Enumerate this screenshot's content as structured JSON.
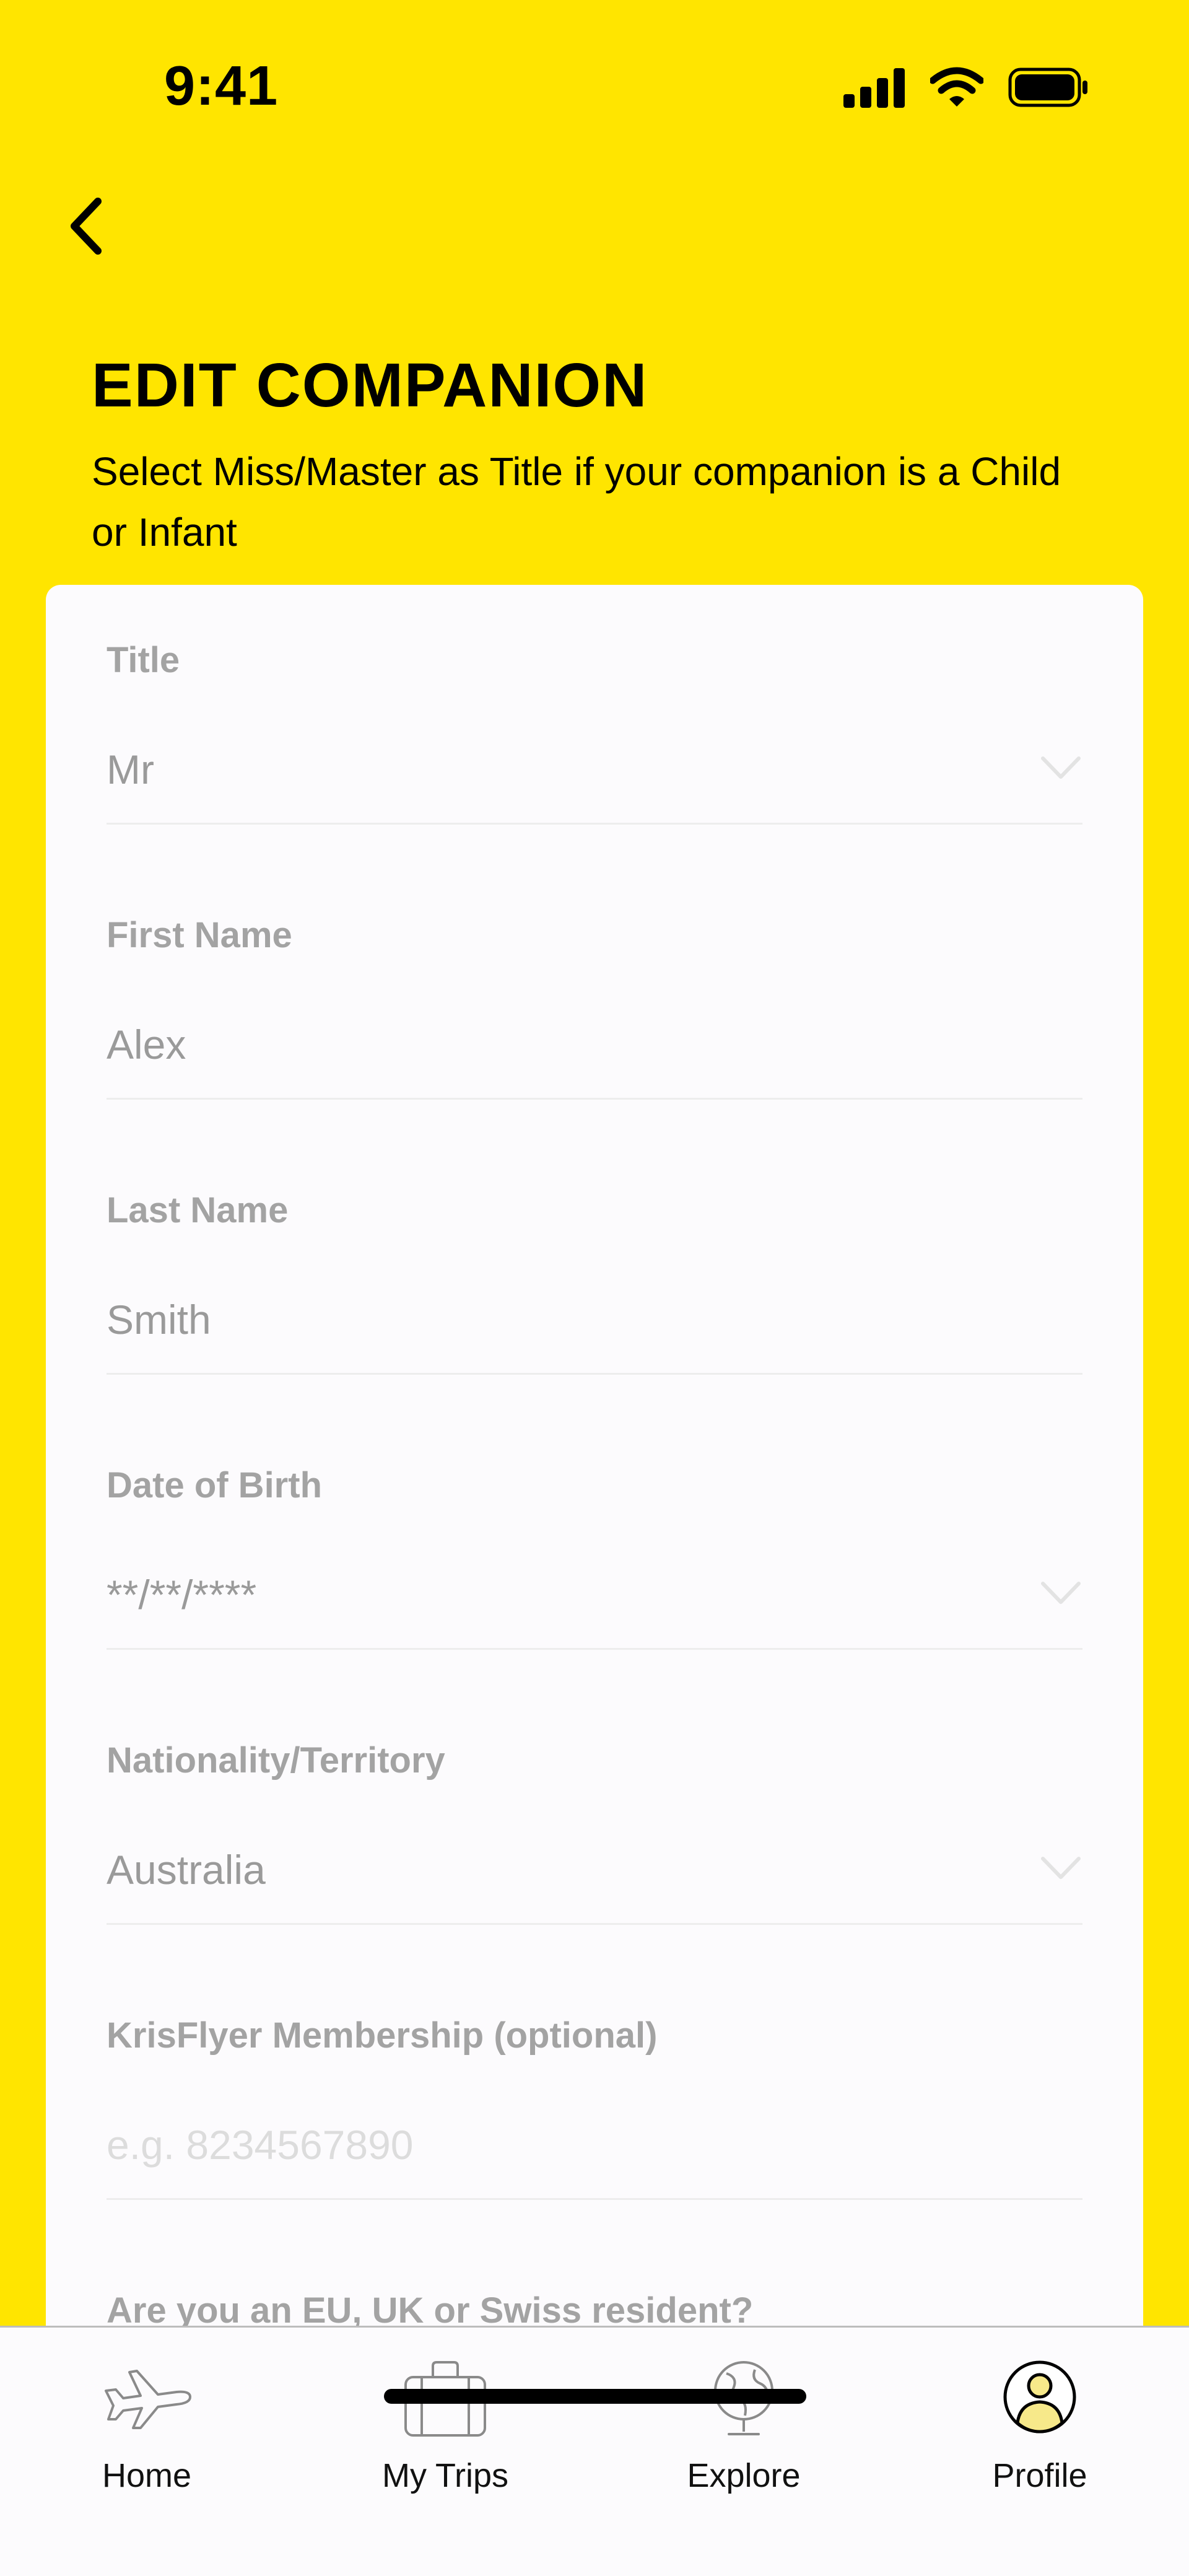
{
  "status_bar": {
    "time": "9:41",
    "battery_level": 1.0
  },
  "header": {
    "title": "EDIT COMPANION",
    "subtitle": "Select Miss/Master as Title if your companion is a Child or Infant"
  },
  "form": {
    "fields": [
      {
        "label": "Title",
        "value": "Mr",
        "type": "select"
      },
      {
        "label": "First Name",
        "value": "Alex",
        "type": "text"
      },
      {
        "label": "Last Name",
        "value": "Smith",
        "type": "text"
      },
      {
        "label": "Date of Birth",
        "value": "**/**/****",
        "type": "select"
      },
      {
        "label": "Nationality/Territory",
        "value": "Australia",
        "type": "select"
      },
      {
        "label": "KrisFlyer Membership (optional)",
        "value": "",
        "placeholder": "e.g. 8234567890",
        "type": "text"
      },
      {
        "label": "Are you an EU, UK or Swiss resident?",
        "type": "question"
      }
    ]
  },
  "tab_bar": {
    "tabs": [
      {
        "label": "Home",
        "icon": "airplane-icon",
        "active": false
      },
      {
        "label": "My Trips",
        "icon": "suitcase-icon",
        "active": false
      },
      {
        "label": "Explore",
        "icon": "globe-icon",
        "active": false
      },
      {
        "label": "Profile",
        "icon": "profile-icon",
        "active": true
      }
    ]
  },
  "colors": {
    "background": "#FFE500",
    "card": "#FCFBFD",
    "label": "#A3A3A3",
    "value": "#9A9A9A",
    "placeholder": "#DCDCDC",
    "avatar_fill": "#F7E98A"
  }
}
